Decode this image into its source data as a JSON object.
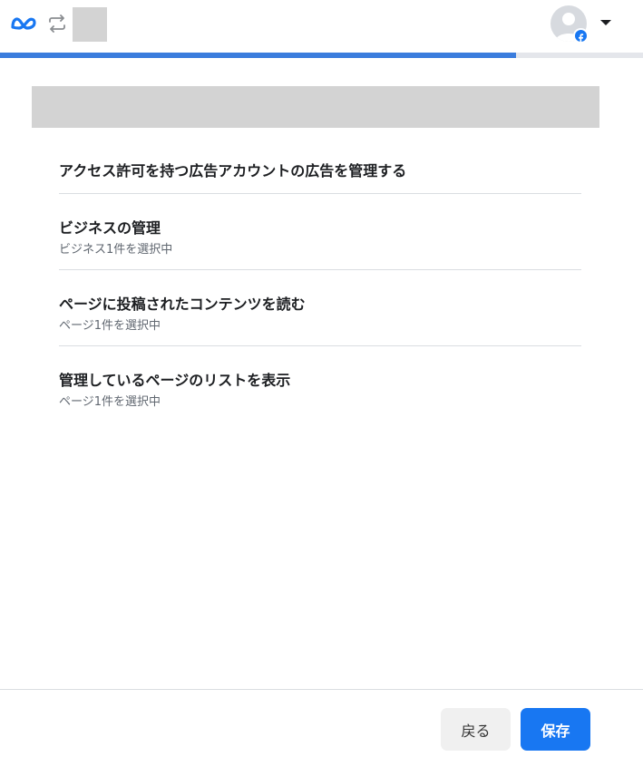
{
  "header": {
    "logo_icon": "meta-logo-icon",
    "swap_icon": "swap-arrows-icon",
    "app_icon": "app-placeholder-icon",
    "avatar_icon": "user-avatar-icon",
    "badge_icon": "facebook-badge-icon",
    "menu_icon": "caret-down-icon"
  },
  "progress": {
    "fraction": 0.803
  },
  "permissions": [
    {
      "title": "アクセス許可を持つ広告アカウントの広告を管理する",
      "subtitle": ""
    },
    {
      "title": "ビジネスの管理",
      "subtitle": "ビジネス1件を選択中"
    },
    {
      "title": "ページに投稿されたコンテンツを読む",
      "subtitle": "ページ1件を選択中"
    },
    {
      "title": "管理しているページのリストを表示",
      "subtitle": "ページ1件を選択中"
    }
  ],
  "footer": {
    "back_label": "戻る",
    "save_label": "保存"
  },
  "colors": {
    "accent": "#1877f2",
    "progress": "#3b7ddd",
    "placeholder": "#d3d3d3"
  }
}
